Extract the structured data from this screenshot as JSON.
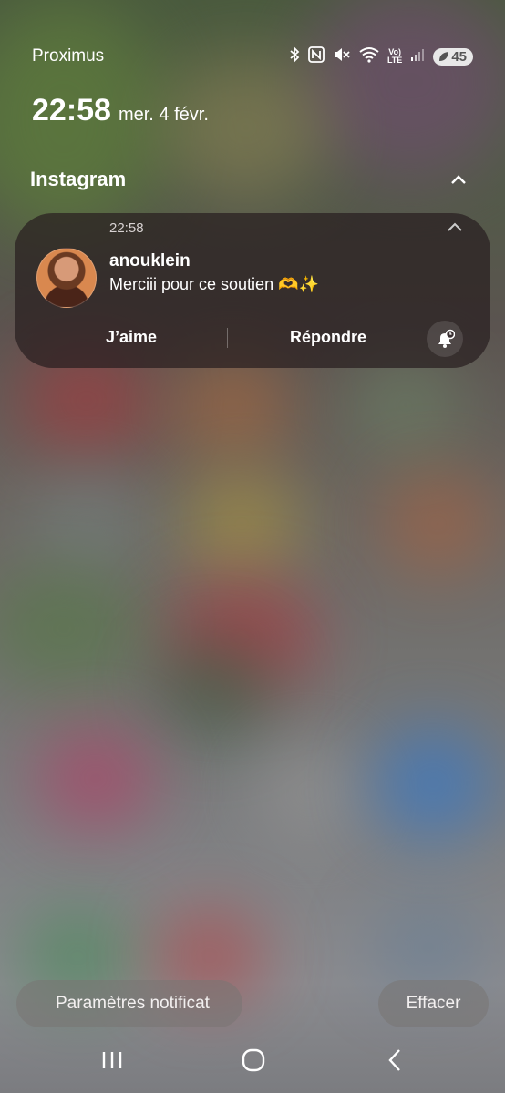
{
  "status_bar": {
    "carrier": "Proximus",
    "battery": "45",
    "network_label_top": "Vo)",
    "network_label_bottom": "LTE",
    "icons": [
      "bluetooth-icon",
      "nfc-icon",
      "mute-icon",
      "wifi-icon",
      "volte-lte-icon",
      "signal-icon",
      "battery-icon"
    ]
  },
  "clock": {
    "time": "22:58",
    "date": "mer. 4 févr."
  },
  "notification_group": {
    "app_name": "Instagram",
    "notification": {
      "time": "22:58",
      "sender": "anouklein",
      "message": "Merciii pour ce soutien 🫶✨",
      "actions": {
        "like_label": "J’aime",
        "reply_label": "Répondre"
      },
      "snooze_icon": "bell-clock-icon"
    }
  },
  "footer": {
    "settings_label": "Paramètres notificat",
    "clear_label": "Effacer"
  },
  "nav": {
    "icons": [
      "recent-apps-icon",
      "home-icon",
      "back-icon"
    ]
  }
}
